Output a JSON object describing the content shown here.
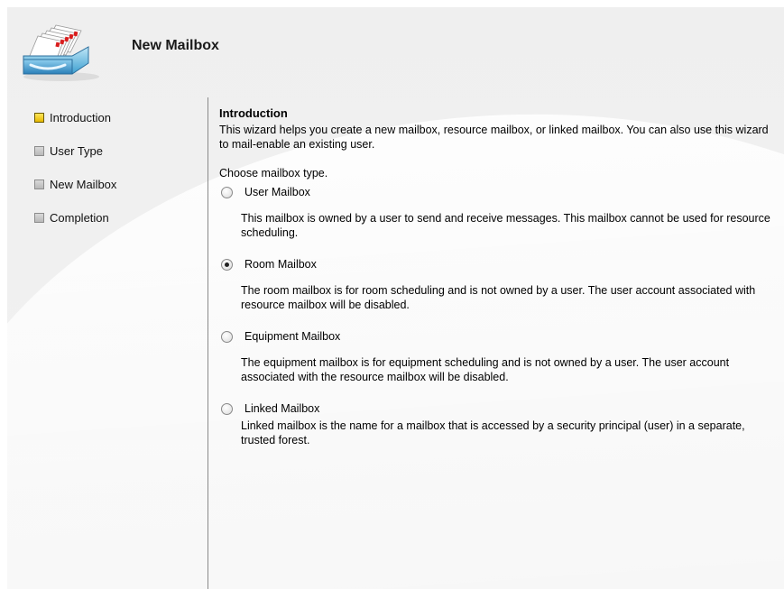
{
  "header": {
    "title": "New Mailbox",
    "icon": "mailbox-tray-icon"
  },
  "nav": {
    "items": [
      {
        "label": "Introduction",
        "state": "active"
      },
      {
        "label": "User Type",
        "state": "inactive"
      },
      {
        "label": "New Mailbox",
        "state": "inactive"
      },
      {
        "label": "Completion",
        "state": "inactive"
      }
    ]
  },
  "content": {
    "title": "Introduction",
    "intro": "This wizard helps you create a new mailbox, resource mailbox, or linked mailbox. You can also use this wizard to mail-enable an existing user.",
    "choose_label": "Choose mailbox type.",
    "options": [
      {
        "label": "User Mailbox",
        "checked": false,
        "description": "This mailbox is owned by a user to send and receive messages. This mailbox cannot be used for resource scheduling."
      },
      {
        "label": "Room Mailbox",
        "checked": true,
        "description": "The room mailbox is for room scheduling and is not owned by a user. The user account associated with resource mailbox will be disabled."
      },
      {
        "label": "Equipment Mailbox",
        "checked": false,
        "description": "The equipment mailbox is for equipment scheduling and is not owned by a user. The user account associated with the resource mailbox will be disabled."
      },
      {
        "label": "Linked Mailbox",
        "checked": false,
        "description": "Linked mailbox is the name for a mailbox that is accessed by a security principal (user) in a separate, trusted forest."
      }
    ]
  },
  "colors": {
    "active_step": "#f0c800",
    "inactive_step": "#c8c8c8",
    "divider": "#8a8a8a"
  }
}
